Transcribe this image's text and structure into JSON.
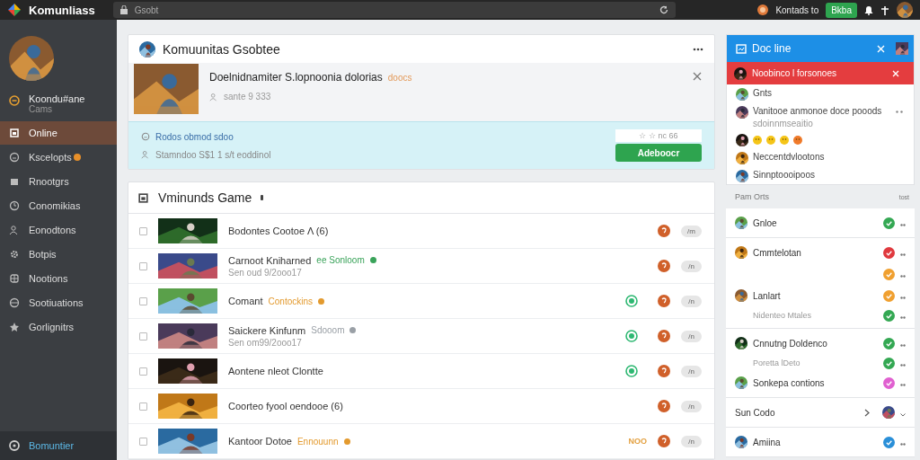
{
  "topbar": {
    "app_title": "Komunliass",
    "search": {
      "placeholder": "Gsobt"
    },
    "user_name": "Kontads to",
    "button": "Bkba"
  },
  "sidebar": {
    "profile": {
      "name": "Koondu#ane",
      "subtitle": "Cams"
    },
    "items": [
      {
        "label": "Online",
        "selected": true,
        "badge": false
      },
      {
        "label": "Kscelopts",
        "selected": false,
        "badge": true
      },
      {
        "label": "Rnootgrs",
        "selected": false,
        "badge": false
      },
      {
        "label": "Conomikias",
        "selected": false,
        "badge": false
      },
      {
        "label": "Eonodtons",
        "selected": false,
        "badge": false
      },
      {
        "label": "Botpis",
        "selected": false,
        "badge": false
      },
      {
        "label": "Nootions",
        "selected": false,
        "badge": false
      },
      {
        "label": "Sootiuations",
        "selected": false,
        "badge": false
      },
      {
        "label": "Gorlignitrs",
        "selected": false,
        "badge": false
      }
    ],
    "footer": "Bomuntier"
  },
  "header_card": {
    "title": "Komuunitas Gsobtee",
    "featured": {
      "title": "Doelnidnamiter S.lopnoonia dolorias",
      "tag": "doocs",
      "meta": "sante 9 333"
    },
    "banner": {
      "link": "Rodos obmod sdoo",
      "line": "Stamndoo S$1 1 s/t eoddinol",
      "tally": "☆ ☆ nc 66",
      "button": "Adeboocr"
    }
  },
  "games": {
    "title": "Vminunds Game",
    "rows": [
      {
        "title": "Bodontes Cootoe Λ (6)",
        "checked": false,
        "online": false,
        "pill": "/m"
      },
      {
        "title": "Carnoot Kniharned",
        "tag": "ee Sonloom",
        "color": "#3aa35a",
        "subtitle": "Sen oud 9/2ooo17",
        "checked": false,
        "online": false,
        "pill": "/n"
      },
      {
        "title": "Comant",
        "tag": "Contockins",
        "color": "#e39a2e",
        "checked": false,
        "online": true,
        "pill": "/n"
      },
      {
        "title": "Saickere Kinfunm",
        "tag": "Sdooom",
        "color": "#9aa0a6",
        "subtitle": "Sen om99/2ooo17",
        "checked": false,
        "online": true,
        "pill": "/n"
      },
      {
        "title": "Aontene nleot Clontte",
        "checked": false,
        "online": true,
        "pill": "/n"
      },
      {
        "title": "Coorteo fyool oendooe (6)",
        "checked": false,
        "online": false,
        "pill": "/n"
      },
      {
        "title": "Kantoor Dotoe",
        "tag": "Ennouunn",
        "color": "#e39a2e",
        "checked": false,
        "online": false,
        "pill": "/n",
        "note": "NOO"
      }
    ]
  },
  "right_panel": {
    "title": "Doc line",
    "alert": "Noobinco l forsonoes",
    "entries": [
      {
        "kind": "plain",
        "text": "Gnts"
      },
      {
        "kind": "message",
        "text": "Vanitooe anmonoe doce pooods",
        "subtitle": "sdoinnmseaitio"
      },
      {
        "kind": "reactions"
      },
      {
        "kind": "plain",
        "text": "Neccentdvlootons"
      },
      {
        "kind": "plain",
        "text": "Sinnptoooipoos"
      }
    ],
    "section": {
      "label": "Pam Orts",
      "action": "tost"
    },
    "groups": [
      [
        {
          "name": "Gnloe",
          "color": "#34a853"
        }
      ],
      [
        {
          "name": "Cmmtelotan",
          "color": "#e0393e"
        },
        {
          "color": "#f0a030"
        },
        {
          "name": "Lanlart",
          "color": "#f0a030"
        },
        {
          "name": "Nidenteo Mtales",
          "sub": true,
          "color": "#34a853"
        }
      ],
      [
        {
          "name": "Cnnutng Doldenco",
          "color": "#34a853"
        },
        {
          "name": "Poretta lDeto",
          "sub": true,
          "color": "#34a853"
        },
        {
          "name": "Sonkepa contions",
          "color": "#e060d0"
        }
      ],
      [
        {
          "name": "Sun Codo",
          "chevron": true
        }
      ],
      [
        {
          "name": "Amiina",
          "color": "#2a8fd8"
        }
      ]
    ]
  }
}
